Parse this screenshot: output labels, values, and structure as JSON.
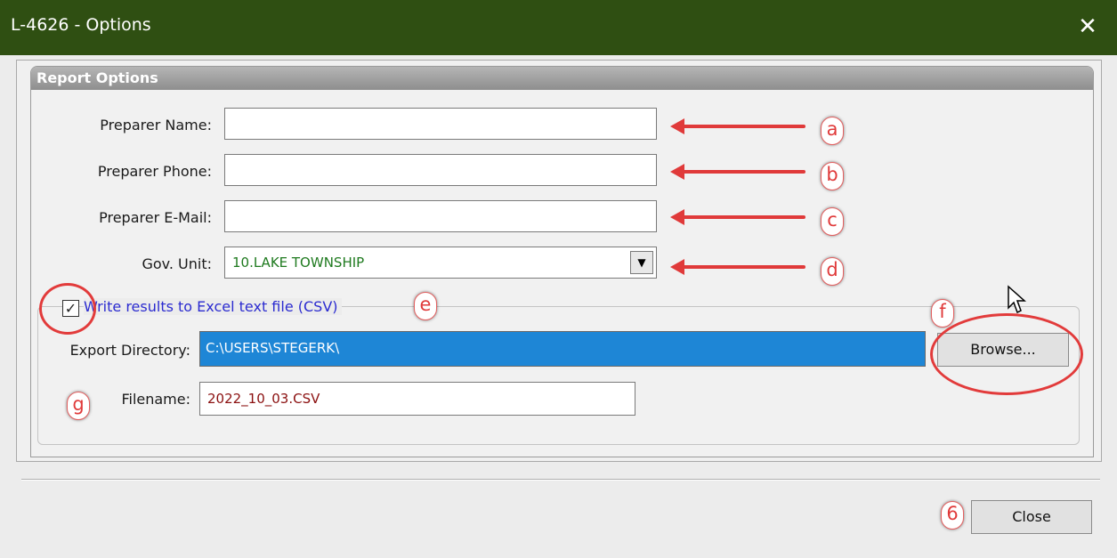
{
  "window": {
    "title": "L-4626 -  Options",
    "close_glyph": "✕"
  },
  "report_options": {
    "header": "Report Options",
    "preparer_name": {
      "label": "Preparer Name:",
      "value": ""
    },
    "preparer_phone": {
      "label": "Preparer Phone:",
      "value": ""
    },
    "preparer_email": {
      "label": "Preparer E-Mail:",
      "value": ""
    },
    "gov_unit": {
      "label": "Gov. Unit:",
      "value": "10.LAKE TOWNSHIP",
      "dropdown_glyph": "▼"
    }
  },
  "export": {
    "checkbox_label": "Write results to Excel text file (CSV)",
    "checked": true,
    "check_glyph": "✓",
    "directory_label": "Export Directory:",
    "directory_value": "C:\\USERS\\STEGERK\\",
    "browse_label": "Browse...",
    "filename_label": "Filename:",
    "filename_value": "2022_10_03.CSV"
  },
  "footer": {
    "close_label": "Close"
  },
  "annotations": {
    "a": "a",
    "b": "b",
    "c": "c",
    "d": "d",
    "e": "e",
    "f": "f",
    "g": "g",
    "six": "6"
  },
  "colors": {
    "titlebar": "#2f4f12",
    "annotation": "#e03a3a",
    "selection": "#1e86d6",
    "combo_text": "#1f7a1f"
  }
}
